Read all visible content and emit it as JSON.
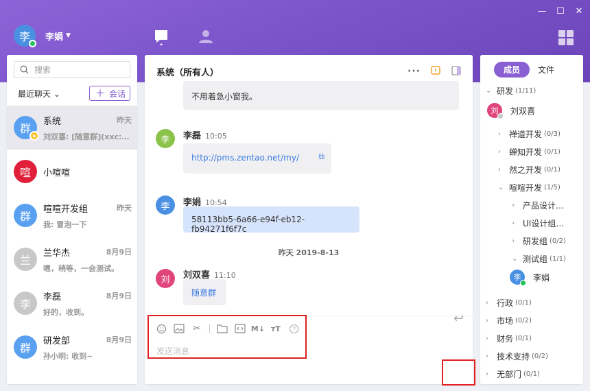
{
  "window": {
    "minimize": "—",
    "maximize": "☐",
    "close": "✕"
  },
  "user": {
    "avatar_char": "李",
    "name": "李娟",
    "avatar_color": "#4a90e2",
    "status_color": "#22c55e"
  },
  "left": {
    "search_placeholder": "搜索",
    "recent_label": "最近聊天",
    "new_label": "会话",
    "conversations": [
      {
        "avatar": "群",
        "color": "#5aa0f0",
        "name": "系统",
        "time": "昨天",
        "preview": "刘双喜: [随意群](xxc://...",
        "active": true,
        "badge": "star"
      },
      {
        "avatar": "喧",
        "color": "#e0203a",
        "name": "小喧喧",
        "time": "",
        "preview": ""
      },
      {
        "avatar": "群",
        "color": "#5aa0f0",
        "name": "喧喧开发组",
        "time": "昨天",
        "preview": "我: 冒泡一下"
      },
      {
        "avatar": "兰",
        "color": "#c8c8c8",
        "name": "兰华杰",
        "time": "8月9日",
        "preview": "嗯，稍等，一会测试。"
      },
      {
        "avatar": "李",
        "color": "#c8c8c8",
        "name": "李磊",
        "time": "8月9日",
        "preview": "好的，收到。"
      },
      {
        "avatar": "群",
        "color": "#5aa0f0",
        "name": "研发部",
        "time": "8月9日",
        "preview": "孙小明: 收到~"
      }
    ]
  },
  "chat": {
    "title": "系统（所有人）",
    "messages": [
      {
        "text": "不用着急小窗我。"
      },
      {
        "sender": "李磊",
        "time": "10:05",
        "avatar": "李",
        "color": "#8bc34a",
        "text": "http://pms.zentao.net/my/"
      },
      {
        "sender": "李娟",
        "time": "10:54",
        "avatar": "李",
        "color": "#4a90e2",
        "text": "58113bb5-6a66-e94f-eb12-fb94271f6f7c"
      },
      {
        "sender": "刘双喜",
        "time": "11:10",
        "avatar": "刘",
        "color": "#e0457b",
        "text": "随意群"
      }
    ],
    "date_separator": "昨天 2019-8-13",
    "input_placeholder": "发送消息"
  },
  "right": {
    "tab_members": "成员",
    "tab_files": "文件",
    "tree": [
      {
        "label": "研发",
        "count": "(1/11)",
        "chev": "⌄"
      },
      {
        "label": "刘双喜",
        "member": true,
        "avatar": "刘",
        "color": "#e0457b",
        "status": "#c8c8c8"
      },
      {
        "label": "禅道开发",
        "count": "(0/3)",
        "chev": "›"
      },
      {
        "label": "蝉知开发",
        "count": "(0/1)",
        "chev": "›"
      },
      {
        "label": "然之开发",
        "count": "(0/1)",
        "chev": "›"
      },
      {
        "label": "喧喧开发",
        "count": "(1/5)",
        "chev": "⌄"
      },
      {
        "label": "产品设计…",
        "count": "",
        "chev": "›"
      },
      {
        "label": "UI设计组…",
        "count": "",
        "chev": "›"
      },
      {
        "label": "研发组",
        "count": "(0/2)",
        "chev": "›"
      },
      {
        "label": "测试组",
        "count": "(1/1)",
        "chev": "⌄"
      },
      {
        "label": "李娟",
        "member": true,
        "avatar": "李",
        "color": "#4a90e2",
        "status": "#22c55e"
      },
      {
        "label": "行政",
        "count": "(0/1)",
        "chev": "›"
      },
      {
        "label": "市场",
        "count": "(0/2)",
        "chev": "›"
      },
      {
        "label": "财务",
        "count": "(0/1)",
        "chev": "›"
      },
      {
        "label": "技术支持",
        "count": "(0/2)",
        "chev": "›"
      },
      {
        "label": "无部门",
        "count": "(0/1)",
        "chev": "›"
      }
    ]
  },
  "colors": {
    "accent": "#8a5fd4",
    "highlight_box": "#e02020"
  }
}
